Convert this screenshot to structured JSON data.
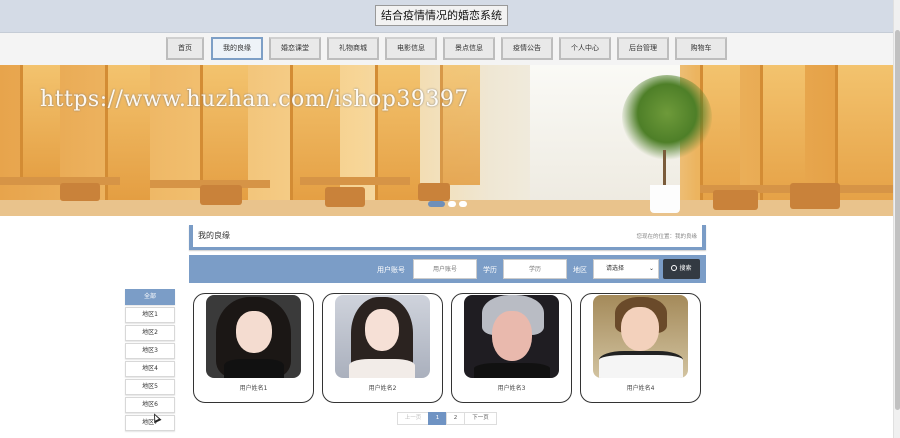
{
  "header": {
    "title": "结合疫情情况的婚恋系统"
  },
  "nav": {
    "items": [
      {
        "label": "首页"
      },
      {
        "label": "我的良缘"
      },
      {
        "label": "婚恋课堂"
      },
      {
        "label": "礼物商城"
      },
      {
        "label": "电影信息"
      },
      {
        "label": "景点信息"
      },
      {
        "label": "疫情公告"
      },
      {
        "label": "个人中心"
      },
      {
        "label": "后台管理"
      },
      {
        "label": "购物车"
      }
    ],
    "active_index": 1
  },
  "banner": {
    "watermark": "https://www.huzhan.com/ishop39397",
    "slide_count": 3,
    "active_slide": 0
  },
  "section": {
    "title": "我的良缘",
    "breadcrumb": "您现在的位置：我的良缘"
  },
  "search": {
    "account_label": "用户账号",
    "account_placeholder": "用户账号",
    "education_label": "学历",
    "education_placeholder": "学历",
    "region_label": "地区",
    "region_select_value": "请选择",
    "button_label": "搜索"
  },
  "regions": {
    "items": [
      "全部",
      "地区1",
      "地区2",
      "地区3",
      "地区4",
      "地区5",
      "地区6",
      "地区7"
    ],
    "active_index": 0
  },
  "cards": [
    {
      "name": "用户姓名1",
      "photo": "portrait-woman-dark-hair"
    },
    {
      "name": "用户姓名2",
      "photo": "portrait-woman-light-top"
    },
    {
      "name": "用户姓名3",
      "photo": "portrait-man-silver-hair"
    },
    {
      "name": "用户姓名4",
      "photo": "portrait-man-white-jacket"
    }
  ],
  "pagination": {
    "prev_label": "上一页",
    "pages": [
      "1",
      "2"
    ],
    "current_page": "1",
    "next_label": "下一页"
  },
  "colors": {
    "accent": "#7b9dc7",
    "header_bg": "#d4dbe6",
    "search_button": "#333a42"
  }
}
